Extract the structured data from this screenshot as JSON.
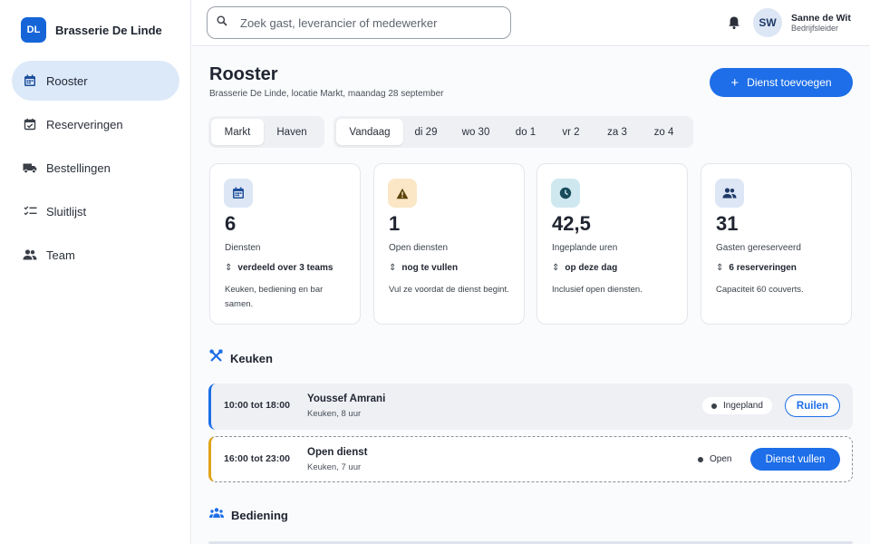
{
  "brand": {
    "initials": "DL",
    "name": "Brasserie De Linde"
  },
  "sidebar": {
    "items": [
      {
        "label": "Rooster",
        "icon": "calendar-icon",
        "active": true
      },
      {
        "label": "Reserveringen",
        "icon": "calendar-check-icon"
      },
      {
        "label": "Bestellingen",
        "icon": "truck-icon"
      },
      {
        "label": "Sluitlijst",
        "icon": "checklist-icon"
      },
      {
        "label": "Team",
        "icon": "people-icon"
      }
    ]
  },
  "topbar": {
    "search_placeholder": "Zoek gast, leverancier of medewerker",
    "user": {
      "initials": "SW",
      "name": "Sanne de Wit",
      "role": "Bedrijfsleider"
    }
  },
  "page": {
    "title": "Rooster",
    "subtitle": "Brasserie De Linde, locatie Markt, maandag 28 september",
    "add_button": "Dienst toevoegen"
  },
  "locations": [
    "Markt",
    "Haven"
  ],
  "days": [
    "Vandaag",
    "di 29",
    "wo 30",
    "do 1",
    "vr 2",
    "za 3",
    "zo 4"
  ],
  "stats": [
    {
      "value": "6",
      "label": "Diensten",
      "trend": "verdeeld over 3 teams",
      "note": "Keuken, bediening en bar samen.",
      "icon": "calendar-icon",
      "icon_bg": "#dce6f5",
      "icon_color": "#1f4f9a"
    },
    {
      "value": "1",
      "label": "Open diensten",
      "trend": "nog te vullen",
      "note": "Vul ze voordat de dienst begint.",
      "icon": "warning-icon",
      "icon_bg": "#fbe7c6",
      "icon_color": "#5a4208"
    },
    {
      "value": "42,5",
      "label": "Ingeplande uren",
      "trend": "op deze dag",
      "note": "Inclusief open diensten.",
      "icon": "clock-icon",
      "icon_bg": "#cfe8f0",
      "icon_color": "#184b5c"
    },
    {
      "value": "31",
      "label": "Gasten gereserveerd",
      "trend": "6 reserveringen",
      "note": "Capaciteit 60 couverts.",
      "icon": "people-icon",
      "icon_bg": "#dce6f5",
      "icon_color": "#1f3a68"
    }
  ],
  "sections": {
    "kitchen": "Keuken",
    "service": "Bediening"
  },
  "shifts": [
    {
      "time": "10:00 tot 18:00",
      "name": "Youssef Amrani",
      "meta": "Keuken, 8 uur",
      "status": "Ingepland",
      "action": "Ruilen"
    },
    {
      "time": "16:00 tot 23:00",
      "name": "Open dienst",
      "meta": "Keuken, 7 uur",
      "status": "Open",
      "action": "Dienst vullen"
    }
  ],
  "colors": {
    "accent": "#1d6ee8",
    "open": "#e0a31a"
  }
}
